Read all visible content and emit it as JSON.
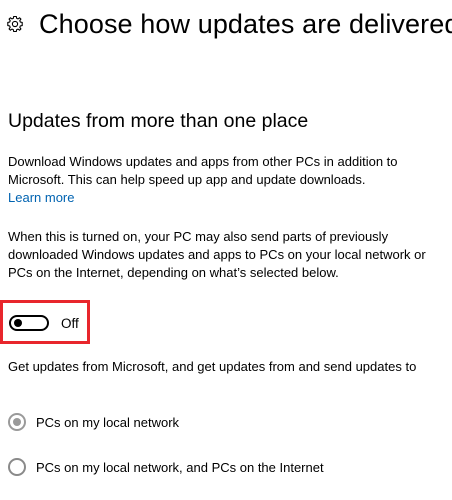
{
  "header": {
    "title": "Choose how updates are delivered",
    "icon": "gear-icon"
  },
  "section": {
    "heading": "Updates from more than one place",
    "description": "Download Windows updates and apps from other PCs in addition to Microsoft. This can help speed up app and update downloads.",
    "learn_more": "Learn more",
    "info": "When this is turned on, your PC may also send parts of previously downloaded Windows updates and apps to PCs on your local network or PCs on the Internet, depending on what’s selected below."
  },
  "toggle": {
    "state": "Off",
    "on": false
  },
  "options": {
    "prompt": "Get updates from Microsoft, and get updates from and send updates to",
    "items": [
      {
        "label": "PCs on my local network",
        "selected": true
      },
      {
        "label": "PCs on my local network, and PCs on the Internet",
        "selected": false
      }
    ]
  },
  "colors": {
    "link": "#0063b1",
    "highlight": "#e8262c",
    "disabled_radio": "#9a9a9a"
  }
}
